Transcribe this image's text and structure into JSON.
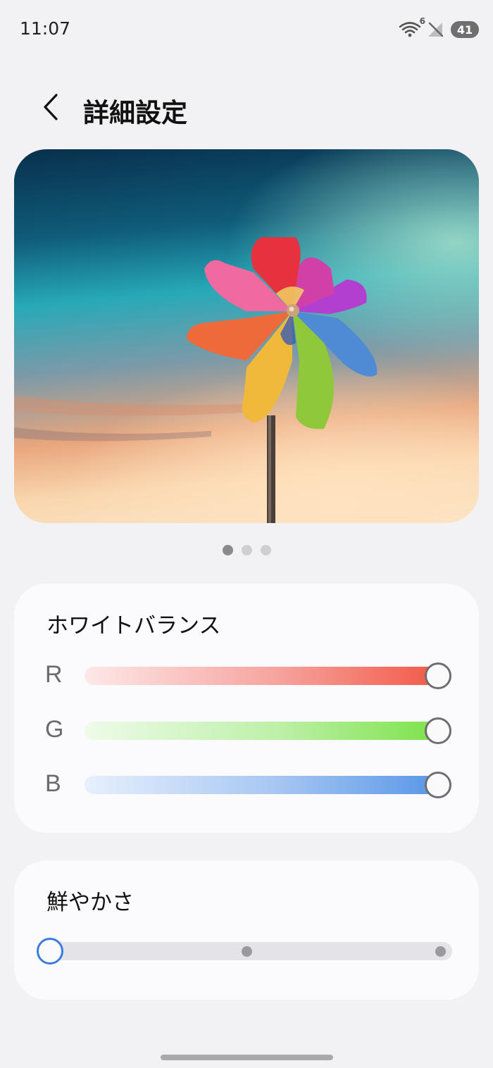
{
  "status_bar": {
    "time": "11:07",
    "wifi_badge": "6",
    "battery": "41",
    "icons": [
      "wifi-icon",
      "no-signal-icon",
      "battery-icon"
    ]
  },
  "header": {
    "title": "詳細設定",
    "back_icon": "chevron-left-icon"
  },
  "preview": {
    "page_count": 3,
    "active_page": 1
  },
  "white_balance": {
    "title": "ホワイトバランス",
    "channels": [
      {
        "label": "R",
        "value": 1.0,
        "color": "#f25a48"
      },
      {
        "label": "G",
        "value": 1.0,
        "color": "#7ee24c"
      },
      {
        "label": "B",
        "value": 1.0,
        "color": "#5a97e8"
      }
    ]
  },
  "vividness": {
    "title": "鮮やかさ",
    "steps": 3,
    "selected_step": 1,
    "accent_color": "#3b7be0"
  }
}
